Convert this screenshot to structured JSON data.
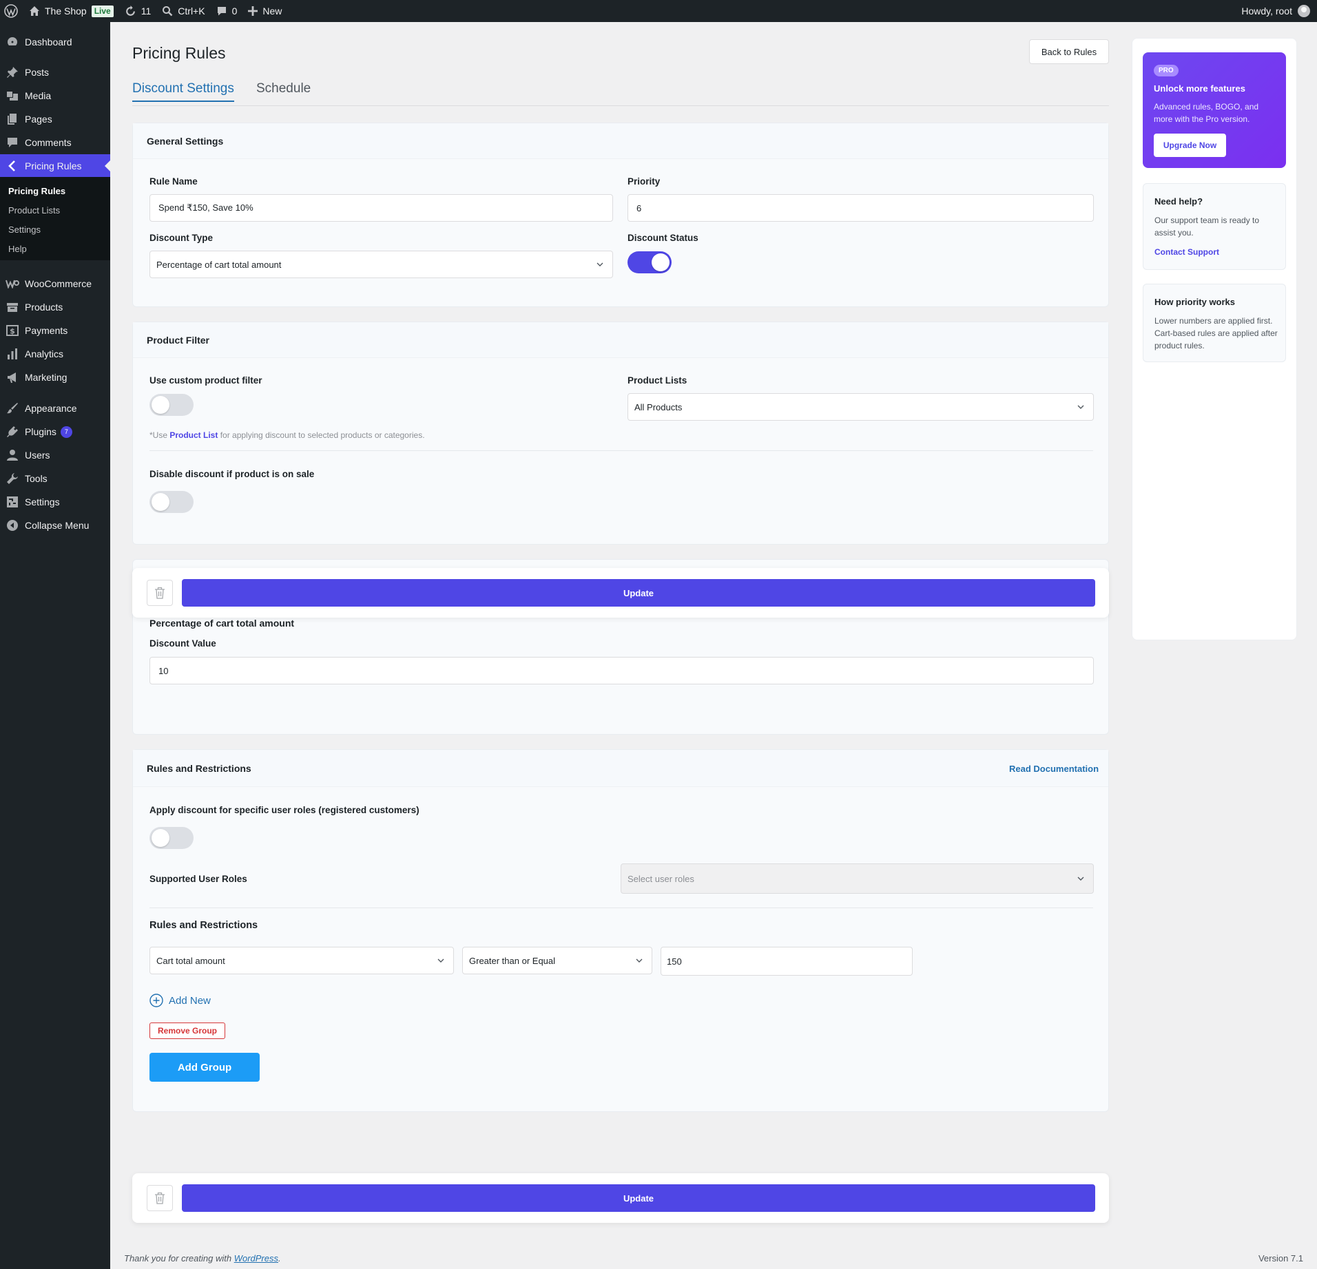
{
  "adminbar": {
    "site_name": "The Shop",
    "live_badge": "Live",
    "updates_count": "11",
    "search_shortcut": "Ctrl+K",
    "comments_count": "0",
    "new_label": "New",
    "howdy": "Howdy, root"
  },
  "sidebar": {
    "dashboard": "Dashboard",
    "posts": "Posts",
    "media": "Media",
    "pages": "Pages",
    "comments": "Comments",
    "pricing_rules": "Pricing Rules",
    "sub_pricing_rules": "Pricing Rules",
    "sub_product_lists": "Product Lists",
    "sub_settings": "Settings",
    "sub_help": "Help",
    "woocommerce": "WooCommerce",
    "products": "Products",
    "payments": "Payments",
    "analytics": "Analytics",
    "marketing": "Marketing",
    "appearance": "Appearance",
    "plugins": "Plugins",
    "plugins_badge": "7",
    "users": "Users",
    "tools": "Tools",
    "settings": "Settings",
    "collapse": "Collapse Menu"
  },
  "page": {
    "title": "Pricing Rules",
    "back_button": "Back to Rules",
    "tabs": [
      "Discount Settings",
      "Schedule"
    ]
  },
  "general": {
    "heading": "General Settings",
    "rule_name_label": "Rule Name",
    "rule_name_value": "Spend ₹150, Save 10%",
    "priority_label": "Priority",
    "priority_value": "6",
    "discount_type_label": "Discount Type",
    "discount_type_value": "Percentage of cart total amount",
    "discount_status_label": "Discount Status",
    "discount_status_on": true
  },
  "product_filter": {
    "heading": "Product Filter",
    "custom_filter_label": "Use custom product filter",
    "custom_filter_on": false,
    "product_lists_label": "Product Lists",
    "product_lists_value": "All Products",
    "note_prefix": "*Use ",
    "note_link": "Product List",
    "note_suffix": " for applying discount to selected products or categories.",
    "disable_on_sale_label": "Disable discount if product is on sale",
    "disable_on_sale_on": false
  },
  "discount": {
    "section_title": "Percentage of cart total amount",
    "value_label": "Discount Value",
    "value": "10"
  },
  "rules": {
    "heading": "Rules and Restrictions",
    "read_docs": "Read Documentation",
    "user_roles_label": "Apply discount for specific user roles (registered customers)",
    "user_roles_on": false,
    "supported_roles_label": "Supported User Roles",
    "supported_roles_placeholder": "Select user roles",
    "sub_heading": "Rules and Restrictions",
    "condition_field": "Cart total amount",
    "condition_operator": "Greater than or Equal",
    "condition_value": "150",
    "add_new": "Add New",
    "remove_group": "Remove Group",
    "add_group": "Add Group"
  },
  "actions": {
    "update": "Update"
  },
  "side_panel": {
    "pro_badge": "PRO",
    "promo_title": "Unlock more features",
    "promo_text": "Advanced rules, BOGO, and more with the Pro version.",
    "upgrade_button": "Upgrade Now",
    "help_title": "Need help?",
    "help_text": "Our support team is ready to assist you.",
    "help_link": "Contact Support",
    "priority_title": "How priority works",
    "priority_text": "Lower numbers are applied first. Cart-based rules are applied after product rules."
  },
  "footer": {
    "thanks_prefix": "Thank you for creating with ",
    "thanks_link": "WordPress",
    "thanks_suffix": ".",
    "version": "Version 7.1"
  },
  "colors": {
    "accent": "#4f46e5",
    "link": "#2271b1",
    "add_group": "#1c9cf6",
    "danger": "#d63638"
  }
}
